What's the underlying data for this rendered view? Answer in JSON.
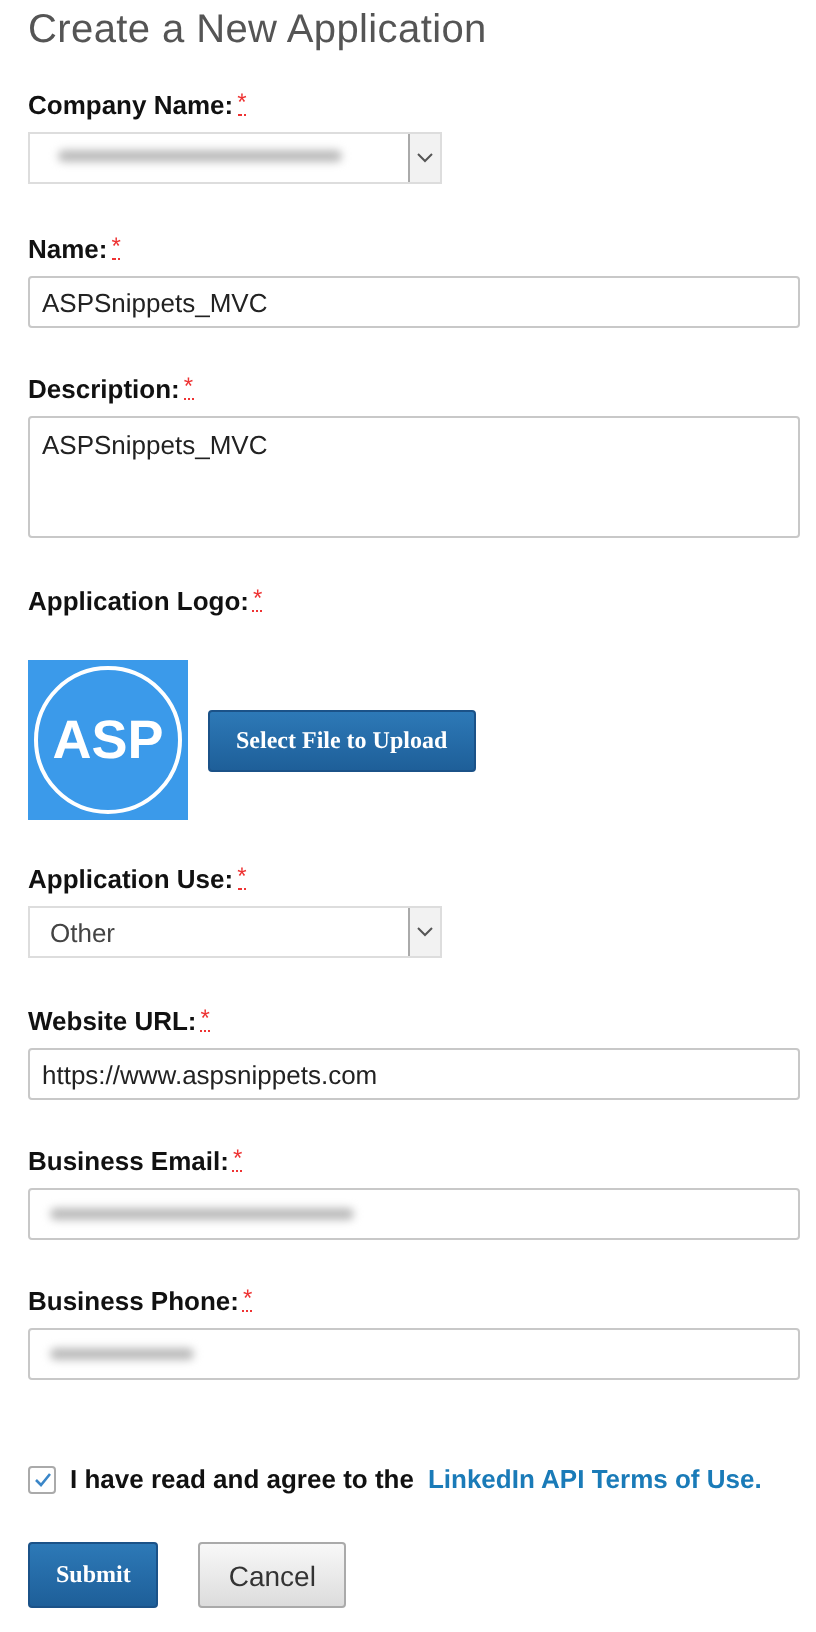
{
  "title": "Create a New Application",
  "fields": [
    {
      "kind": "select",
      "label": "Company Name:",
      "required_mark": "*",
      "redacted": true
    },
    {
      "kind": "text",
      "label": "Name:",
      "required_mark": "*",
      "value": "ASPSnippets_MVC"
    },
    {
      "kind": "textarea",
      "label": "Description:",
      "required_mark": "*",
      "value": "ASPSnippets_MVC"
    },
    {
      "kind": "logo",
      "label": "Application Logo:",
      "required_mark": "*",
      "logo_text": "ASP",
      "button": "Select File to Upload"
    },
    {
      "kind": "select",
      "label": "Application Use:",
      "required_mark": "*",
      "value": "Other"
    },
    {
      "kind": "text",
      "label": "Website URL:",
      "required_mark": "*",
      "value": "https://www.aspsnippets.com"
    },
    {
      "kind": "text",
      "label": "Business Email:",
      "required_mark": "*",
      "redacted": true
    },
    {
      "kind": "text",
      "label": "Business Phone:",
      "required_mark": "*",
      "redacted": true
    }
  ],
  "agree": {
    "checked": true,
    "text": "I have read and agree to the",
    "link": "LinkedIn API Terms of Use."
  },
  "buttons": [
    {
      "kind": "primary",
      "label": "Submit"
    },
    {
      "kind": "secondary",
      "label": "Cancel"
    }
  ]
}
